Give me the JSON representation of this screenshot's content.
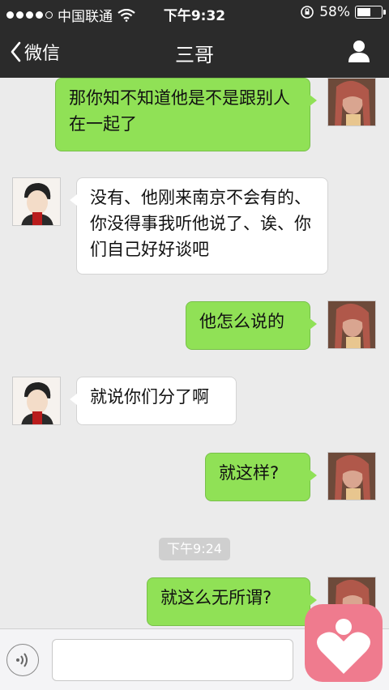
{
  "status_bar": {
    "signal_dots": 5,
    "carrier": "中国联通",
    "time": "下午9:32",
    "battery_percent_text": "58%",
    "battery_level": 0.58
  },
  "nav": {
    "back_label": "微信",
    "title": "三哥"
  },
  "messages": [
    {
      "from": "me",
      "text": "那你知不知道他是不是跟别人在一起了"
    },
    {
      "from": "them",
      "text": "没有、他刚来南京不会有的、你没得事我听他说了、诶、你们自己好好谈吧"
    },
    {
      "from": "me",
      "text": "他怎么说的"
    },
    {
      "from": "them",
      "text": "就说你们分了啊"
    },
    {
      "from": "me",
      "text": "就这样?"
    },
    {
      "from": "me",
      "text": "就这么无所谓?"
    }
  ],
  "timestamp_divider": "下午9:24",
  "colors": {
    "nav_bg": "#2b2b2b",
    "chat_bg": "#ebebeb",
    "my_bubble": "#90e156",
    "their_bubble": "#ffffff",
    "heart_app": "#ef7b8e"
  },
  "icons": {
    "back": "chevron-left-icon",
    "profile": "person-icon",
    "voice": "voice-icon",
    "overlay": "heart-app-icon"
  }
}
